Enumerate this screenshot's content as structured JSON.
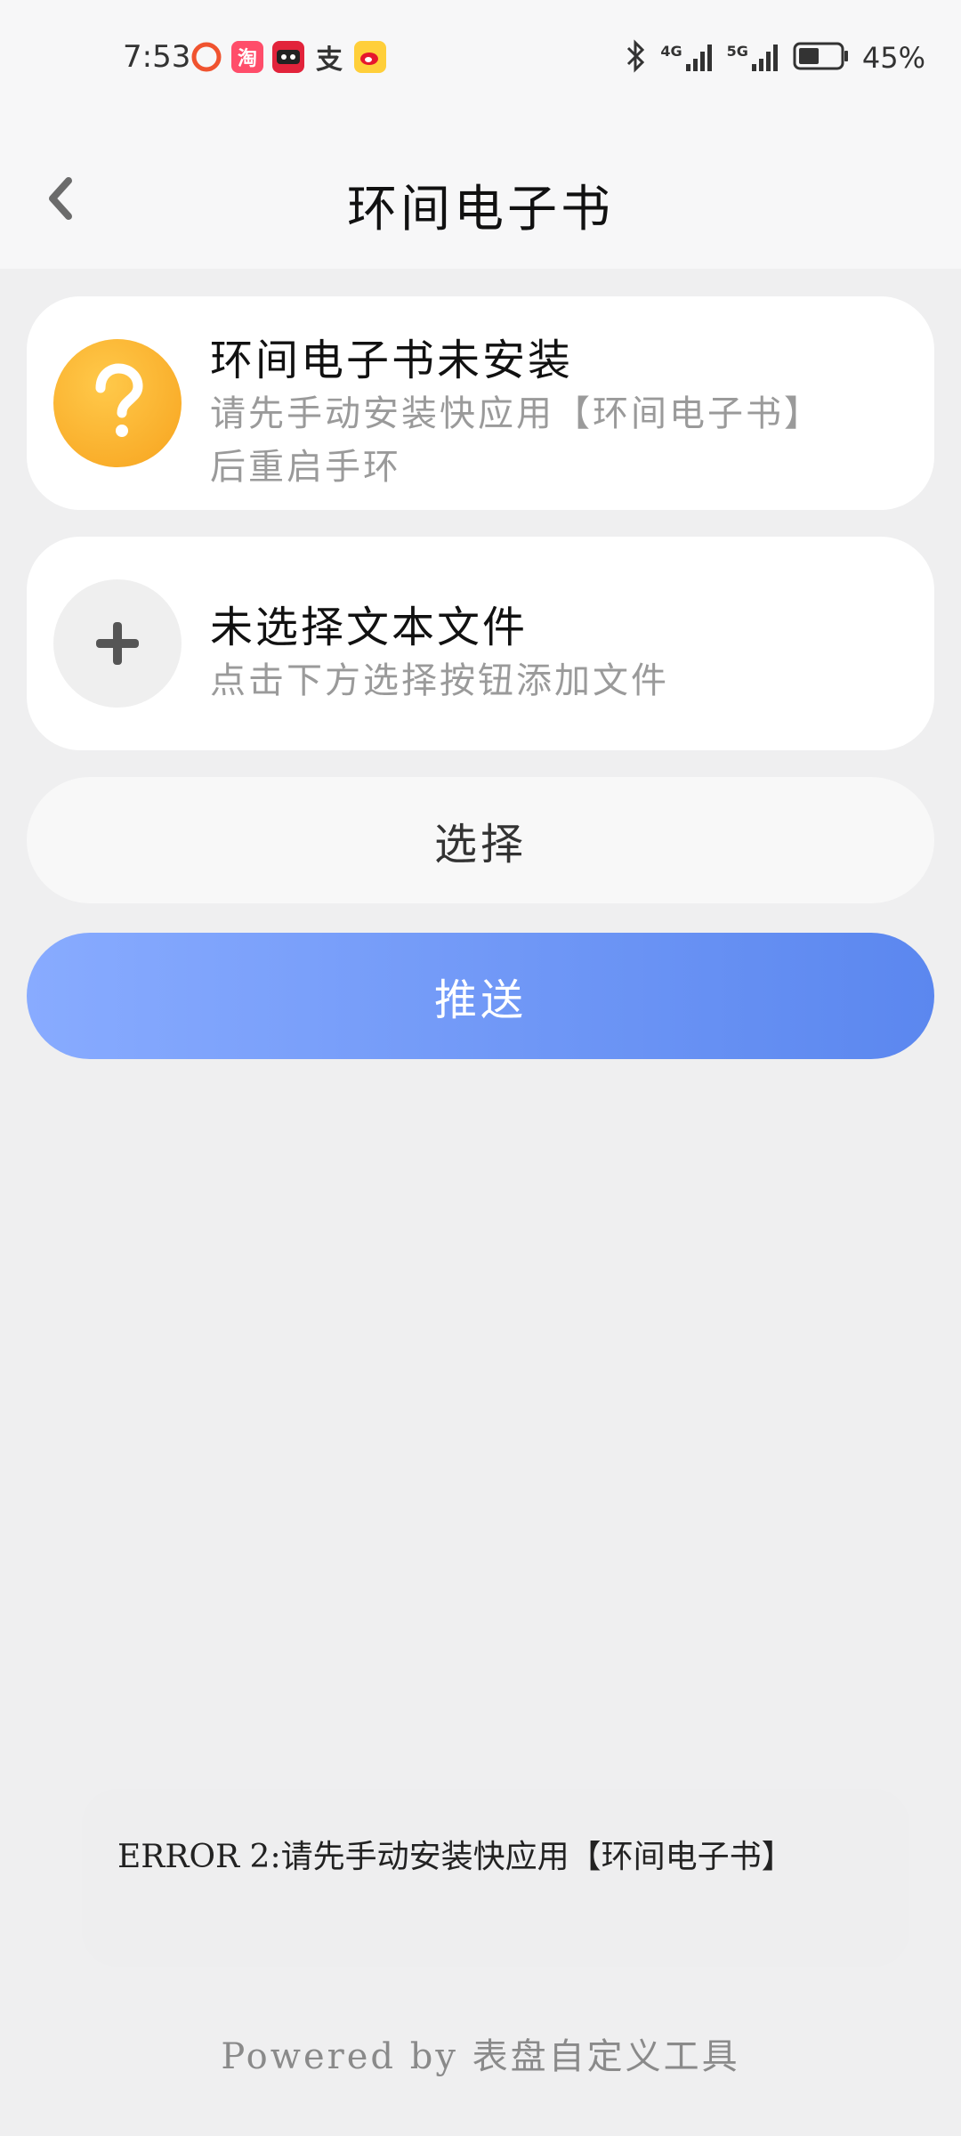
{
  "status_bar": {
    "time": "7:53",
    "battery_percent": "45%",
    "network_4g": "4G",
    "network_5g": "5G",
    "icons": [
      "record-icon",
      "taobao-icon",
      "tmall-icon",
      "alipay-icon",
      "weibo-icon"
    ]
  },
  "header": {
    "title": "环间电子书"
  },
  "install_card": {
    "title": "环间电子书未安装",
    "description": "请先手动安装快应用【环间电子书】后重启手环"
  },
  "file_card": {
    "title": "未选择文本文件",
    "description": "点击下方选择按钮添加文件"
  },
  "buttons": {
    "select_label": "选择",
    "push_label": "推送"
  },
  "error": {
    "message": "ERROR 2:请先手动安装快应用【环间电子书】"
  },
  "footer": {
    "text": "Powered by 表盘自定义工具"
  },
  "colors": {
    "accent_start": "#88abff",
    "accent_end": "#5b87ef",
    "warning": "#f7a31e"
  }
}
